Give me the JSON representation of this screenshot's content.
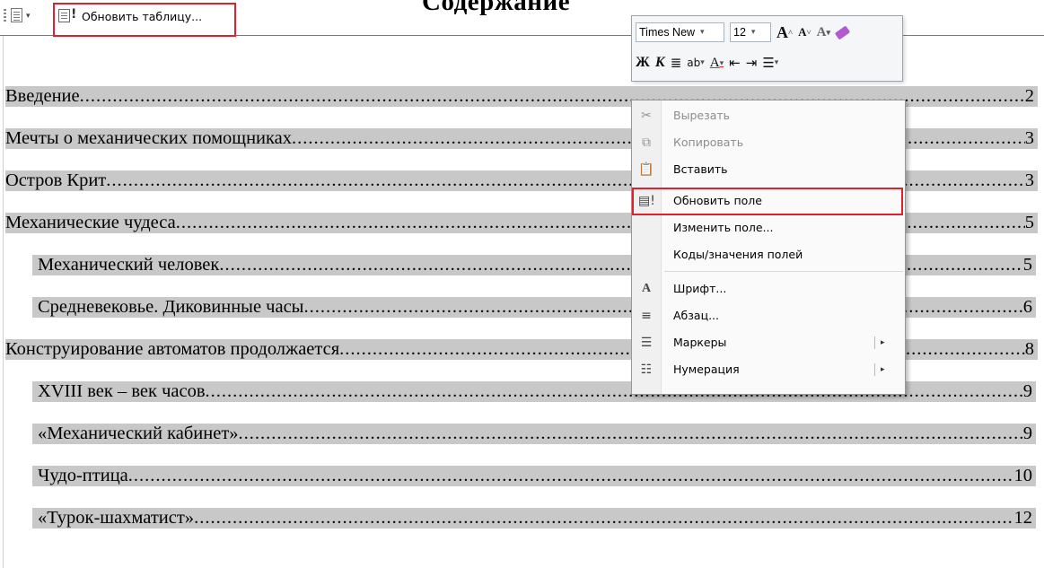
{
  "heading": "Содержание",
  "toc_toolbar": {
    "menu_arrow": "▾",
    "update_table_label": "Обновить таблицу..."
  },
  "toc_entries": [
    {
      "title": "Введение",
      "page": "2",
      "level": 1
    },
    {
      "title": "Мечты о механических помощниках ",
      "page": "3",
      "level": 1
    },
    {
      "title": "Остров Крит",
      "page": "3",
      "level": 1
    },
    {
      "title": "Механические чудеса",
      "page": "5",
      "level": 1
    },
    {
      "title": "Механический человек",
      "page": "5",
      "level": 2
    },
    {
      "title": "Средневековье. Диковинные часы",
      "page": "6",
      "level": 2
    },
    {
      "title": "Конструирование автоматов продолжается ",
      "page": "8",
      "level": 1
    },
    {
      "title": "XVIII век – век часов ",
      "page": "9",
      "level": 2
    },
    {
      "title": "«Механический кабинет»",
      "page": "9",
      "level": 2
    },
    {
      "title": "Чудо-птица",
      "page": "10",
      "level": 2
    },
    {
      "title": "«Турок-шахматист»",
      "page": "12",
      "level": 2
    }
  ],
  "mini_toolbar": {
    "font_name": "Times New",
    "font_size": "12",
    "dropdown_glyph": "▾",
    "grow_font": "A",
    "shrink_font": "A",
    "bold": "Ж",
    "italic": "К",
    "center": "≣",
    "highlight": "ab",
    "font_color": "A",
    "decrease_indent": "⇤",
    "increase_indent": "⇥",
    "bullets": "☰"
  },
  "context_menu": {
    "items": [
      {
        "label": "Вырезать",
        "icon": "scissors-icon",
        "disabled": true
      },
      {
        "label": "Копировать",
        "icon": "copy-icon",
        "disabled": true
      },
      {
        "label": "Вставить",
        "icon": "paste-icon",
        "disabled": false
      },
      {
        "label": "Обновить поле",
        "icon": "update-field-icon",
        "disabled": false
      },
      {
        "label": "Изменить поле...",
        "icon": "",
        "disabled": false
      },
      {
        "label": "Коды/значения полей",
        "icon": "",
        "disabled": false
      },
      {
        "label": "Шрифт...",
        "icon": "font-icon",
        "disabled": false
      },
      {
        "label": "Абзац...",
        "icon": "paragraph-icon",
        "disabled": false
      },
      {
        "label": "Маркеры",
        "icon": "bullets-icon",
        "disabled": false,
        "submenu": true
      },
      {
        "label": "Нумерация",
        "icon": "numbering-icon",
        "disabled": false,
        "submenu": true
      }
    ],
    "submenu_glyph": "▸"
  },
  "accent_color": "#e0202d"
}
